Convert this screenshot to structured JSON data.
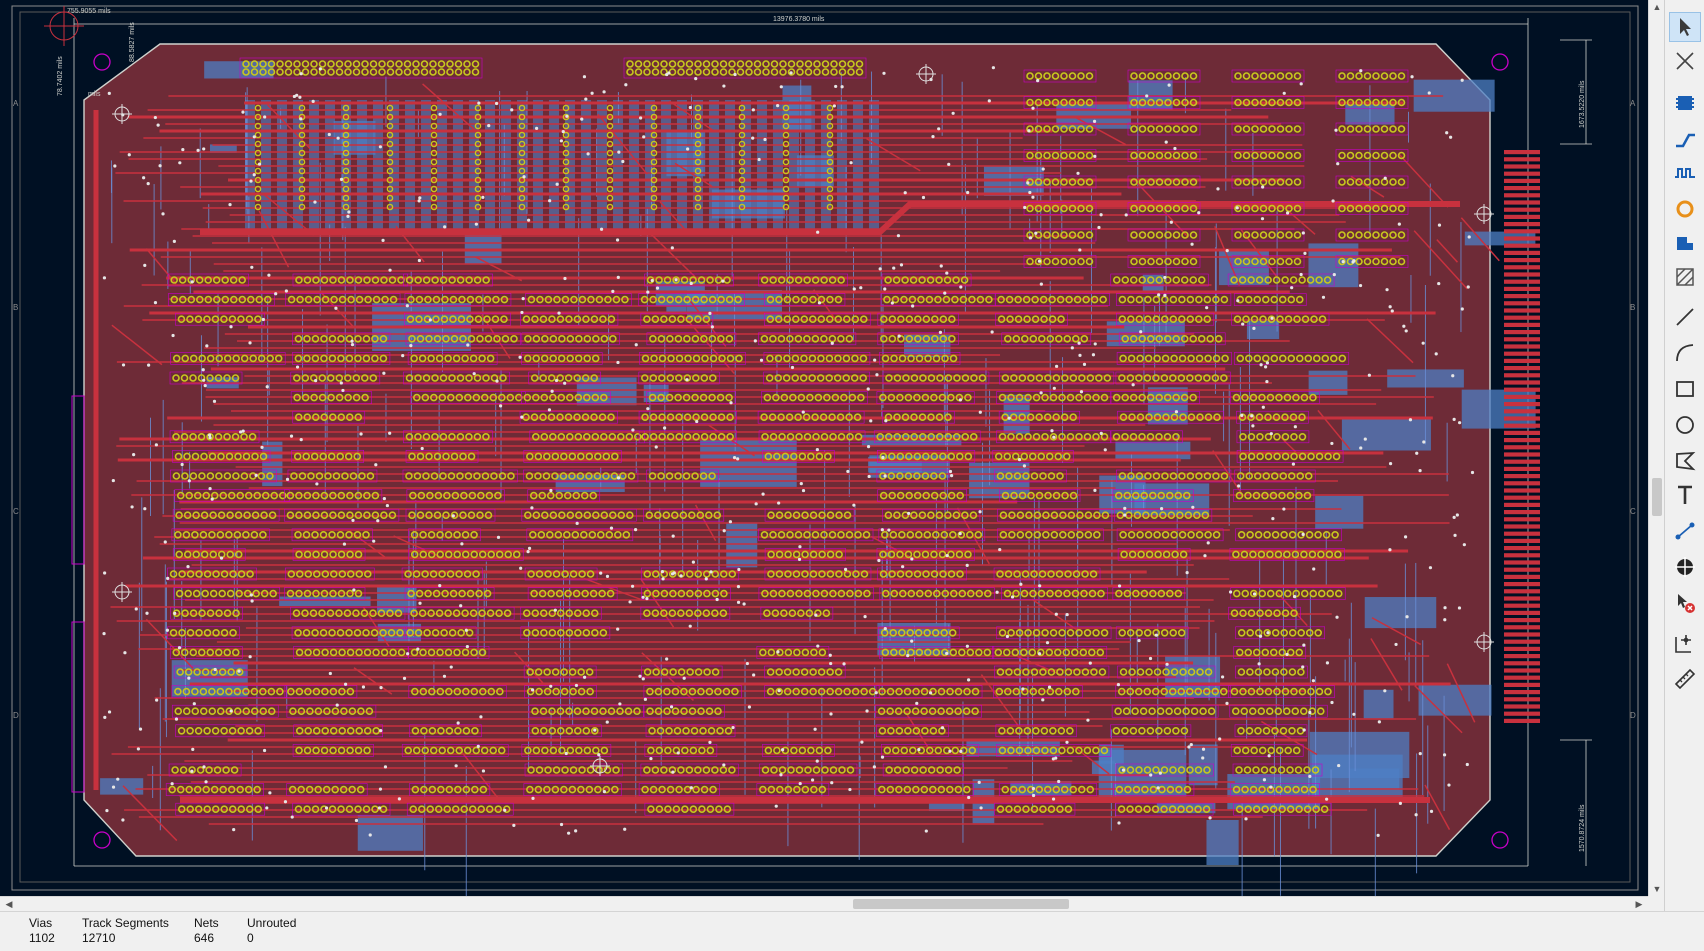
{
  "dimensions": {
    "top": "13976.3780 mils",
    "top_left": "755.9055 mils",
    "left_a": "78.7402 mils",
    "left_b": "88.5827 mils",
    "left_mils": "mils",
    "right_top": "1673.5220 mils",
    "right_bottom": "1570.8724 mils"
  },
  "frame": {
    "row_labels": [
      "A",
      "B",
      "C",
      "D"
    ]
  },
  "toolbar": {
    "tools": [
      {
        "name": "select-tool",
        "icon": "cursor-icon"
      },
      {
        "name": "local-ratsnest-tool",
        "icon": "ratsnest-icon"
      },
      {
        "name": "add-footprint-tool",
        "icon": "footprint-icon"
      },
      {
        "name": "route-track-tool",
        "icon": "route-track-icon"
      },
      {
        "name": "tune-length-tool",
        "icon": "tune-length-icon"
      },
      {
        "name": "add-via-tool",
        "icon": "via-icon"
      },
      {
        "name": "add-zone-tool",
        "icon": "zone-icon"
      },
      {
        "name": "add-keepout-tool",
        "icon": "keepout-icon"
      },
      {
        "name": "draw-line-tool",
        "icon": "line-icon"
      },
      {
        "name": "draw-arc-tool",
        "icon": "arc-icon"
      },
      {
        "name": "draw-rectangle-tool",
        "icon": "rectangle-icon"
      },
      {
        "name": "draw-circle-tool",
        "icon": "circle-icon"
      },
      {
        "name": "draw-polygon-tool",
        "icon": "polygon-icon"
      },
      {
        "name": "add-text-tool",
        "icon": "text-icon"
      },
      {
        "name": "add-dimension-tool",
        "icon": "dimension-icon"
      },
      {
        "name": "add-target-tool",
        "icon": "target-icon"
      },
      {
        "name": "delete-tool",
        "icon": "delete-icon"
      },
      {
        "name": "set-origin-tool",
        "icon": "origin-icon"
      },
      {
        "name": "measure-tool",
        "icon": "ruler-icon"
      }
    ]
  },
  "status": {
    "vias_label": "Vias",
    "vias_value": "1102",
    "tracks_label": "Track Segments",
    "tracks_value": "12710",
    "nets_label": "Nets",
    "nets_value": "646",
    "unrouted_label": "Unrouted",
    "unrouted_value": "0"
  },
  "colors": {
    "canvas": "#001023",
    "board_fill": "#6e2b37",
    "front_copper": "#c8313e",
    "back_copper": "#4d7fc4",
    "pad_ring": "#c8c81e",
    "via": "#e6e6e6",
    "edge_cuts": "#d0d2cd",
    "silkscreen": "#c800c8",
    "accent_select": "#cfe4f7"
  }
}
